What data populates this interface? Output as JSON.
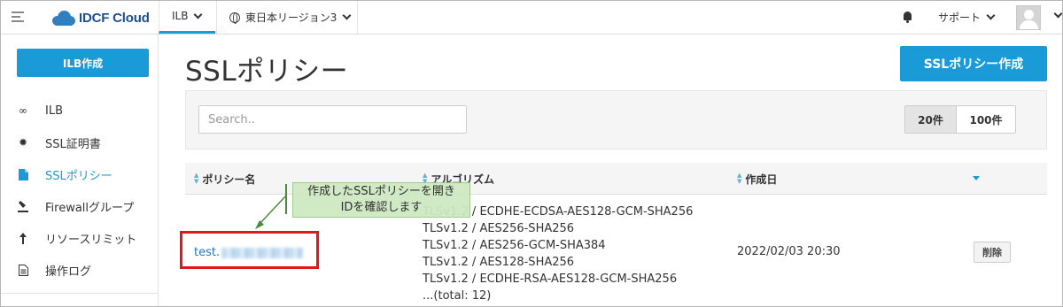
{
  "topbar": {
    "brand": "IDCF Cloud",
    "service_menu": "ILB",
    "region_menu": "東日本リージョン3",
    "support_menu": "サポート"
  },
  "sidebar": {
    "create_button": "ILB作成",
    "items": [
      {
        "label": "ILB",
        "icon": "infinity-icon"
      },
      {
        "label": "SSL証明書",
        "icon": "seal-icon"
      },
      {
        "label": "SSLポリシー",
        "icon": "document-icon",
        "active": true
      },
      {
        "label": "Firewallグループ",
        "icon": "shield-icon"
      },
      {
        "label": "リソースリミット",
        "icon": "arrow-up-icon"
      },
      {
        "label": "操作ログ",
        "icon": "log-icon"
      }
    ]
  },
  "main": {
    "title": "SSLポリシー",
    "create_button": "SSLポリシー作成",
    "search_placeholder": "Search..",
    "per_page_options": [
      "20件",
      "100件"
    ],
    "per_page_selected": "20件",
    "table": {
      "columns": [
        "ポリシー名",
        "アルゴリズム",
        "作成日"
      ],
      "rows": [
        {
          "name_prefix": "test.",
          "algorithms": [
            "TLSv1.2 / ECDHE-ECDSA-AES128-GCM-SHA256",
            "TLSv1.2 / AES256-SHA256",
            "TLSv1.2 / AES256-GCM-SHA384",
            "TLSv1.2 / AES128-SHA256",
            "TLSv1.2 / ECDHE-RSA-AES128-GCM-SHA256",
            "...(total: 12)"
          ],
          "created": "2022/02/03 20:30",
          "delete_label": "削除"
        }
      ]
    }
  },
  "annotation": {
    "line1": "作成したSSLポリシーを開き",
    "line2": "IDを確認します"
  },
  "colors": {
    "accent": "#1a9ad6",
    "link": "#1a78c2",
    "highlight": "#e3161e",
    "callout_bg": "#cfe9c3"
  }
}
